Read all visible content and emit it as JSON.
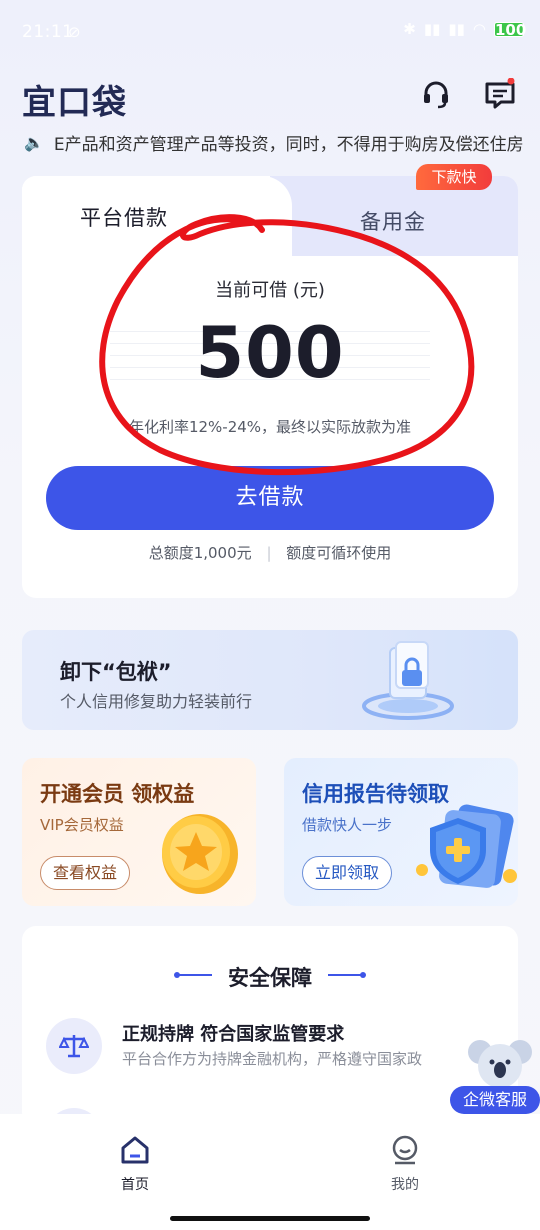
{
  "status_bar": {
    "time": "21:11",
    "battery": "100"
  },
  "header": {
    "logo": "宜口袋",
    "icons": [
      "headset-icon",
      "message-icon"
    ]
  },
  "notice": {
    "text": "E产品和资产管理产品等投资，同时，不得用于购房及偿还住房"
  },
  "loan_card": {
    "tab_platform": "平台借款",
    "tab_reserve": "备用金",
    "fast_badge": "下款快",
    "amount_label": "当前可借 (元)",
    "amount": "500",
    "rate_text": "年化利率12%-24%，最终以实际放款为准",
    "borrow_button": "去借款",
    "total_quota": "总额度1,000元",
    "quota_note": "额度可循环使用"
  },
  "banner": {
    "title": "卸下“包袱”",
    "subtitle": "个人信用修复助力轻装前行"
  },
  "promo_vip": {
    "title": "开通会员 领权益",
    "subtitle": "VIP会员权益",
    "button": "查看权益"
  },
  "promo_credit": {
    "title": "信用报告待领取",
    "subtitle": "借款快人一步",
    "button": "立即领取"
  },
  "security": {
    "title": "安全保障",
    "item_title": "正规持牌 符合国家监管要求",
    "item_desc": "平台合作方为持牌金融机构，严格遵守国家政"
  },
  "float_service": {
    "label": "企微客服"
  },
  "bottom_nav": {
    "home": "首页",
    "mine": "我的"
  },
  "colors": {
    "primary": "#3d55e8",
    "annotation": "#e8141a",
    "badge": "#f23c3c"
  }
}
